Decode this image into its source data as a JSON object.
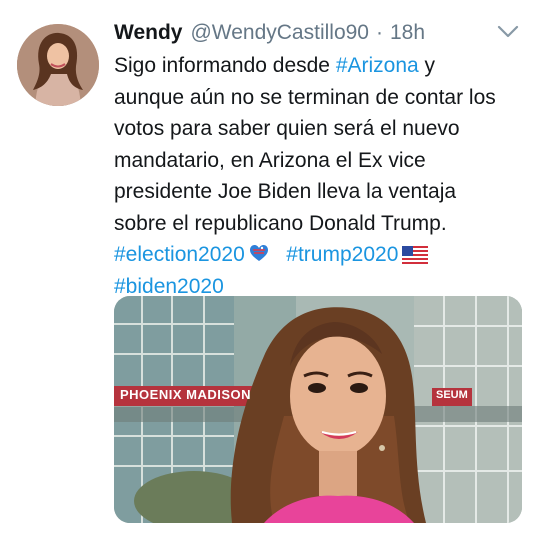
{
  "tweet": {
    "author_name": "Wendy",
    "author_handle": "@WendyCastillo90",
    "separator": "·",
    "timestamp": "18h",
    "text_lines": [
      [
        "Sigo informando desde ",
        "#Arizona",
        " y"
      ],
      "aunque aún no se terminan de contar los",
      "votos para saber quien será el nuevo",
      "mandatario,  en Arizona el Ex vice",
      "presidente Joe Biden  lleva la ventaja",
      "sobre el republicano Donald Trump."
    ],
    "line1_pre": "Sigo informando desde ",
    "line1_tag": "#Arizona",
    "line1_post": " y",
    "line2": "aunque aún no se terminan de contar los",
    "line3": "votos para saber quien será el nuevo",
    "line4": "mandatario,  en Arizona el Ex vice",
    "line5": "presidente Joe Biden  lleva la ventaja",
    "line6": "sobre el republicano Donald Trump.",
    "hashtags": {
      "election": "#election2020",
      "trump": "#trump2020",
      "biden": "#biden2020"
    },
    "emojis": [
      "ballot-heart-icon",
      "us-flag-icon"
    ],
    "media": {
      "sign_text": "PHOENIX MADISON",
      "sign_text_right": "SEUM"
    }
  },
  "colors": {
    "link": "#1b95e0",
    "muted": "#657786",
    "text": "#14171a"
  }
}
